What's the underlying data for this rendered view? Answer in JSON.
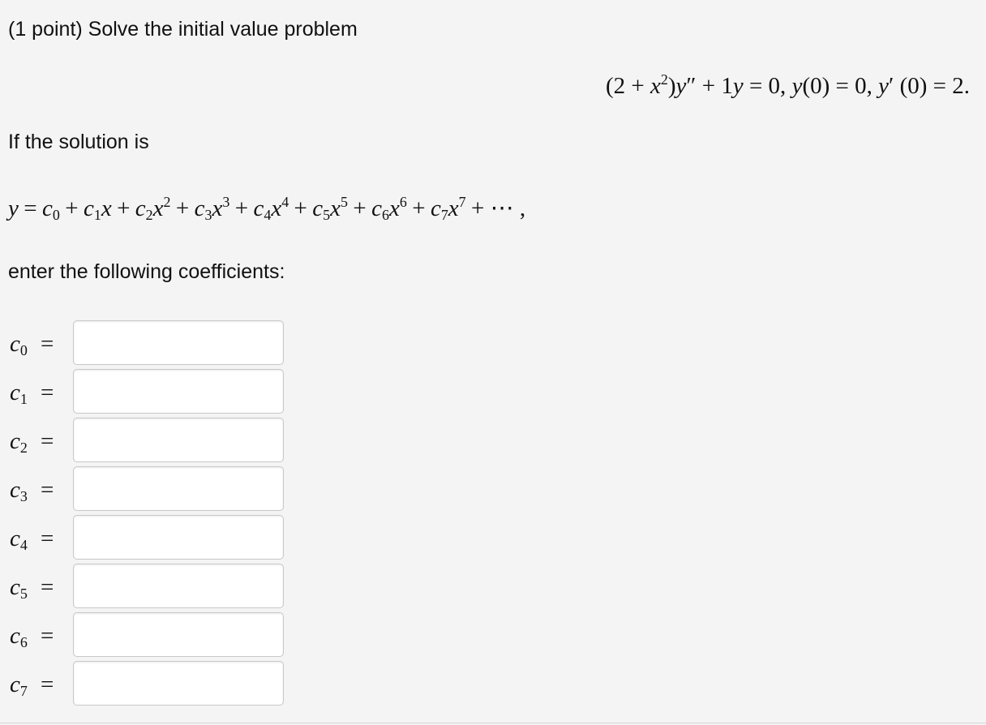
{
  "problem": {
    "intro": "(1 point) Solve the initial value problem",
    "if_solution": "If the solution is",
    "enter": "enter the following coefficients:"
  },
  "equation": {
    "open": "(2 +",
    "x": "x",
    "x_exp": "2",
    "close": ")",
    "y": "y",
    "y_prime2": "″",
    "plus": "+",
    "coef": "1",
    "y2": "y",
    "eq_zero": "= 0,",
    "cond1_y": "y",
    "cond1_rest": "(0) = 0,",
    "cond2_y": "y",
    "cond2_prime": "′",
    "cond2_rest": "(0) = 2."
  },
  "series": {
    "lhs": "y",
    "eq": "=",
    "c": "c",
    "x": "x",
    "terms": [
      {
        "sub": "0",
        "exp": ""
      },
      {
        "sub": "1",
        "exp": ""
      },
      {
        "sub": "2",
        "exp": "2"
      },
      {
        "sub": "3",
        "exp": "3"
      },
      {
        "sub": "4",
        "exp": "4"
      },
      {
        "sub": "5",
        "exp": "5"
      },
      {
        "sub": "6",
        "exp": "6"
      },
      {
        "sub": "7",
        "exp": "7"
      }
    ],
    "plus": "+",
    "tail": "+ ⋯ ,"
  },
  "coefficients": [
    {
      "c": "c",
      "sub": "0",
      "eq": "=",
      "value": ""
    },
    {
      "c": "c",
      "sub": "1",
      "eq": "=",
      "value": ""
    },
    {
      "c": "c",
      "sub": "2",
      "eq": "=",
      "value": ""
    },
    {
      "c": "c",
      "sub": "3",
      "eq": "=",
      "value": ""
    },
    {
      "c": "c",
      "sub": "4",
      "eq": "=",
      "value": ""
    },
    {
      "c": "c",
      "sub": "5",
      "eq": "=",
      "value": ""
    },
    {
      "c": "c",
      "sub": "6",
      "eq": "=",
      "value": ""
    },
    {
      "c": "c",
      "sub": "7",
      "eq": "=",
      "value": ""
    }
  ]
}
